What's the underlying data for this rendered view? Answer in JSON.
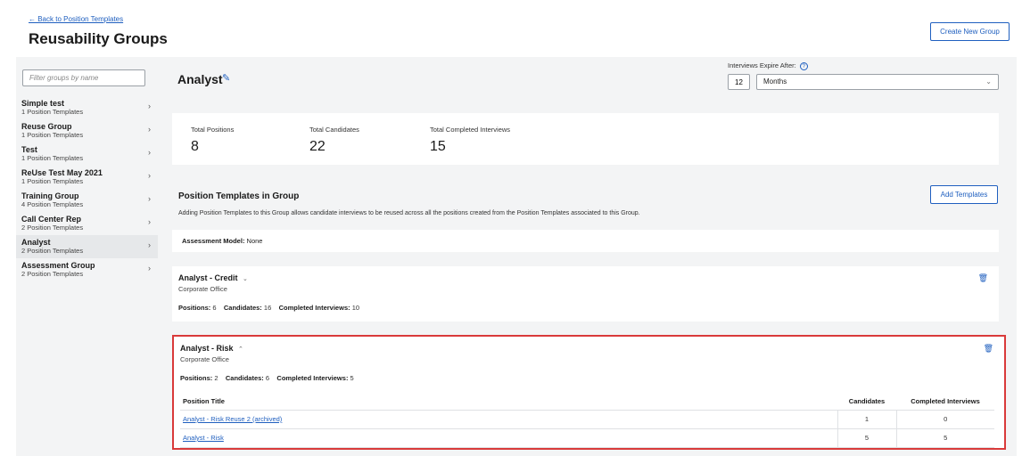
{
  "header": {
    "back_link": "← Back to Position Templates",
    "title": "Reusability Groups",
    "create_button": "Create New Group"
  },
  "sidebar": {
    "filter_placeholder": "Filter groups by name",
    "items": [
      {
        "name": "Simple test",
        "sub": "1 Position Templates"
      },
      {
        "name": "Reuse Group",
        "sub": "1 Position Templates"
      },
      {
        "name": "Test",
        "sub": "1 Position Templates"
      },
      {
        "name": "ReUse Test May 2021",
        "sub": "1 Position Templates"
      },
      {
        "name": "Training Group",
        "sub": "4 Position Templates"
      },
      {
        "name": "Call Center Rep",
        "sub": "2 Position Templates"
      },
      {
        "name": "Analyst",
        "sub": "2 Position Templates",
        "selected": true
      },
      {
        "name": "Assessment Group",
        "sub": "2 Position Templates"
      }
    ]
  },
  "main": {
    "group_title": "Analyst",
    "expire": {
      "label": "Interviews Expire After:",
      "value": "12",
      "unit": "Months"
    },
    "stats": [
      {
        "label": "Total Positions",
        "value": "8"
      },
      {
        "label": "Total Candidates",
        "value": "22"
      },
      {
        "label": "Total Completed Interviews",
        "value": "15"
      }
    ],
    "section_title": "Position Templates in Group",
    "section_desc": "Adding Position Templates to this Group allows candidate interviews to be reused across all the positions created from the Position Templates associated to this Group.",
    "add_button": "Add Templates",
    "assessment": {
      "label": "Assessment Model:",
      "value": "None"
    },
    "templates": [
      {
        "name": "Analyst - Credit",
        "office": "Corporate Office",
        "positions_label": "Positions:",
        "positions": "6",
        "candidates_label": "Candidates:",
        "candidates": "16",
        "completed_label": "Completed Interviews:",
        "completed": "10"
      },
      {
        "name": "Analyst - Risk",
        "office": "Corporate Office",
        "positions_label": "Positions:",
        "positions": "2",
        "candidates_label": "Candidates:",
        "candidates": "6",
        "completed_label": "Completed Interviews:",
        "completed": "5",
        "table": {
          "headers": [
            "Position Title",
            "Candidates",
            "Completed Interviews"
          ],
          "rows": [
            [
              "Analyst - Risk Reuse 2 (archived)",
              "1",
              "0"
            ],
            [
              "Analyst - Risk",
              "5",
              "5"
            ]
          ]
        }
      }
    ]
  },
  "colors": {
    "accent": "#1f5fbf",
    "highlight_border": "#d93a3a",
    "panel_bg": "#f3f4f5"
  }
}
